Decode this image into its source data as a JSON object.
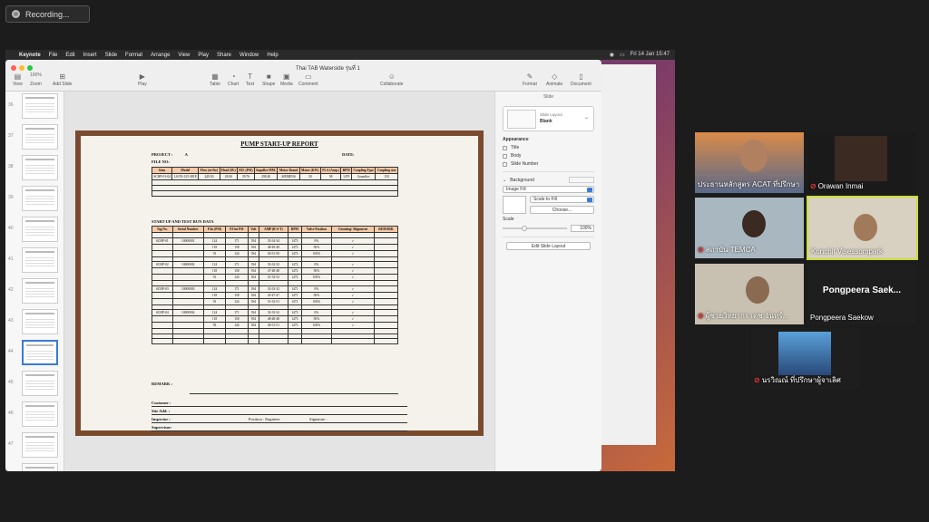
{
  "recording": {
    "label": "Recording..."
  },
  "menubar": {
    "app": "Keynote",
    "items": [
      "File",
      "Edit",
      "Insert",
      "Slide",
      "Format",
      "Arrange",
      "View",
      "Play",
      "Share",
      "Window",
      "Help"
    ],
    "clock": "Fri 14 Jan  15:47"
  },
  "keynote": {
    "doc_title": "Thai TAB Waterside รุ่นที่ 1",
    "toolbar": {
      "view": "View",
      "zoom_value": "100%",
      "zoom": "Zoom",
      "add_slide": "Add Slide",
      "play": "Play",
      "table": "Table",
      "chart": "Chart",
      "text": "Text",
      "shape": "Shape",
      "media": "Media",
      "comment": "Comment",
      "collaborate": "Collaborate",
      "format": "Format",
      "animate": "Animate",
      "document": "Document"
    },
    "thumb_numbers": [
      "36",
      "37",
      "38",
      "39",
      "40",
      "41",
      "42",
      "43",
      "44",
      "45",
      "46",
      "47",
      "48"
    ]
  },
  "report": {
    "title": "PUMP START-UP REPORT",
    "project_label": "PROJECT :",
    "project_value": "A",
    "date_label": "DATE:",
    "file_label": "FILE NO:",
    "t1_headers": [
      "Item",
      "Model",
      "Flow (m³/hr)",
      "Head (M.)",
      "P.D. (PSI)",
      "Impeller MM.",
      "Motor Brand",
      "Motor (KW)",
      "FLA (Amp.)",
      "RPM",
      "Coupling Type",
      "Coupling size"
    ],
    "t1_row": [
      "SCHP-01-04",
      "LS150-125-381E",
      "249.50",
      "28.00",
      "39.76",
      "298.40",
      "SIEMENS",
      "30",
      "58",
      "1470",
      "Grundfos",
      "150"
    ],
    "run_title": "START-UP AND TEST RUN DATA",
    "t2_headers": [
      "Tag No.",
      "Serial Number",
      "P.In (PSI)",
      "P.Out PSI",
      "Volt",
      "AMP (R-S-T)",
      "RPM",
      "Valve Position",
      "Grouting/ Alignment",
      "REMARK"
    ],
    "groups": [
      {
        "tag": "SCHP-01",
        "serial": "10000001",
        "rows": [
          [
            "124",
            "171",
            "394",
            "33-34-34",
            "1473",
            "0%"
          ],
          [
            "118",
            "158",
            "394",
            "48-49-48",
            "1473",
            "50%"
          ],
          [
            "91",
            "124",
            "394",
            "50-51-50",
            "1473",
            "100%"
          ]
        ]
      },
      {
        "tag": "SCHP-02",
        "serial": "10000002",
        "rows": [
          [
            "124",
            "171",
            "394",
            "33-32-33",
            "1472",
            "0%"
          ],
          [
            "118",
            "158",
            "394",
            "47-48-48",
            "1472",
            "50%"
          ],
          [
            "91",
            "124",
            "394",
            "51-52-52",
            "1472",
            "100%"
          ]
        ]
      },
      {
        "tag": "SCHP-03",
        "serial": "10000003",
        "rows": [
          [
            "124",
            "171",
            "394",
            "33-33-32",
            "1471",
            "0%"
          ],
          [
            "118",
            "158",
            "394",
            "45-47-47",
            "1471",
            "50%"
          ],
          [
            "91",
            "124",
            "394",
            "51-52-51",
            "1471",
            "100%"
          ]
        ]
      },
      {
        "tag": "SCHP-04",
        "serial": "10000004",
        "rows": [
          [
            "124",
            "171",
            "394",
            "32-33-32",
            "1473",
            "0%"
          ],
          [
            "118",
            "158",
            "394",
            "48-48-48",
            "1473",
            "50%"
          ],
          [
            "93",
            "126",
            "394",
            "49-51-51",
            "1473",
            "100%"
          ]
        ]
      }
    ],
    "remark_label": "REMARK :",
    "customer_label": "Customer :",
    "site_label": "Site Add. :",
    "inspector_label": "Inspector :",
    "position_label": "Position : Engineer",
    "signature_label": "Signature :",
    "supervisor_label": "Supervisor:"
  },
  "format_panel": {
    "tab": "Slide",
    "layout_label": "Slide Layout",
    "layout_value": "Blank",
    "appearance": "Appearance",
    "opt_title": "Title",
    "opt_body": "Body",
    "opt_slide_number": "Slide Number",
    "background": "Background",
    "fill_type": "Image Fill",
    "scale_mode": "Scale to Fill",
    "choose": "Choose...",
    "scale_label": "Scale",
    "scale_value": "100%",
    "edit_layout": "Edit Slide Layout"
  },
  "participants": [
    {
      "name": "ประธานหลักสูตร ACAT ที่ปรึกษา"
    },
    {
      "name": "Orawan Inmai"
    },
    {
      "name": "สถาบัน TEMCA"
    },
    {
      "name": "Kunchit Visessompark"
    },
    {
      "name": "ผู้ช่วยวิทยากร เดช จันทร์..."
    },
    {
      "name": "Pongpeera Saekow",
      "tile_text": "Pongpeera Saek..."
    },
    {
      "name": "นรวิณณ์ ที่ปรึกษาผู้จาเลิศ"
    }
  ]
}
